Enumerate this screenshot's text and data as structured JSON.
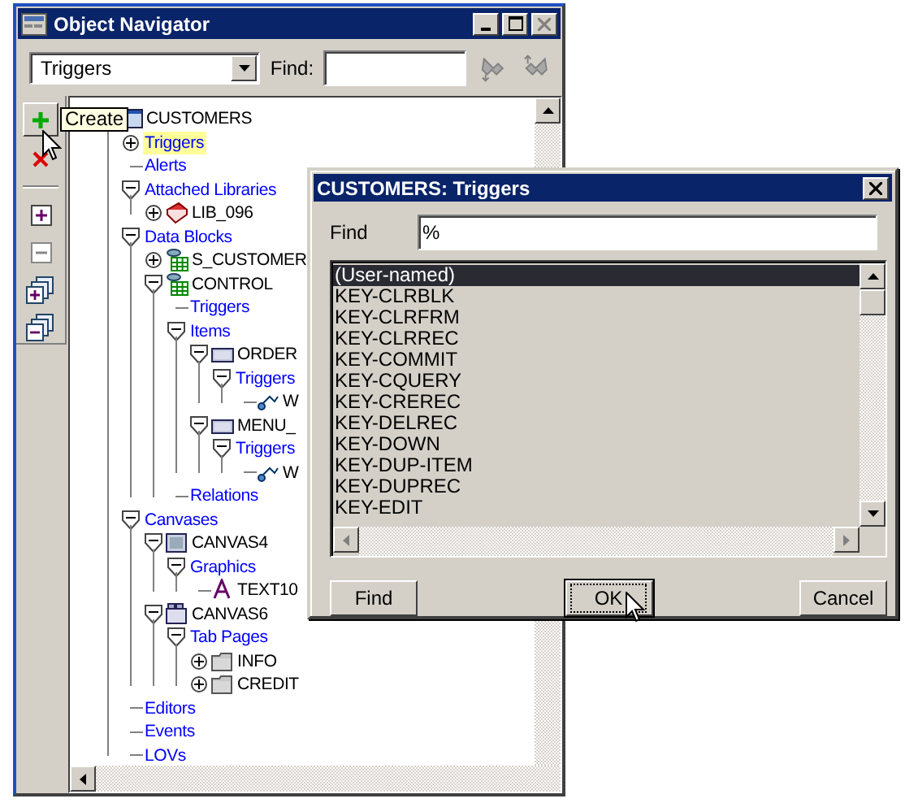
{
  "window": {
    "title": "Object Navigator"
  },
  "toolbar": {
    "filter": "Triggers",
    "find_label": "Find:"
  },
  "side_toolbar": {
    "tooltip": "Create"
  },
  "tree": [
    {
      "label": "CUSTOMERS",
      "kind": "form",
      "selected": false,
      "children": [
        {
          "label": "Triggers",
          "kind": "category",
          "selected": true,
          "expanded": false
        },
        {
          "label": "Alerts",
          "kind": "category",
          "selected": false
        },
        {
          "label": "Attached Libraries",
          "kind": "category",
          "selected": false,
          "expanded": true,
          "children": [
            {
              "label": "LIB_096",
              "kind": "library",
              "selected": false,
              "expanded": false
            }
          ]
        },
        {
          "label": "Data Blocks",
          "kind": "category",
          "selected": false,
          "expanded": true,
          "children": [
            {
              "label": "S_CUSTOMER",
              "kind": "block",
              "selected": false,
              "expanded": false
            },
            {
              "label": "CONTROL",
              "kind": "block",
              "selected": false,
              "expanded": true,
              "children": [
                {
                  "label": "Triggers",
                  "kind": "category",
                  "selected": false
                },
                {
                  "label": "Items",
                  "kind": "category",
                  "selected": false,
                  "expanded": true,
                  "children": [
                    {
                      "label": "ORDER",
                      "kind": "item",
                      "selected": false,
                      "expanded": true,
                      "children": [
                        {
                          "label": "Triggers",
                          "kind": "category",
                          "selected": false,
                          "expanded": true,
                          "children": [
                            {
                              "label": "W",
                              "kind": "trigger",
                              "selected": false
                            }
                          ]
                        }
                      ]
                    },
                    {
                      "label": "MENU_",
                      "kind": "item",
                      "selected": false,
                      "expanded": true,
                      "children": [
                        {
                          "label": "Triggers",
                          "kind": "category",
                          "selected": false,
                          "expanded": true,
                          "children": [
                            {
                              "label": "W",
                              "kind": "trigger",
                              "selected": false
                            }
                          ]
                        }
                      ]
                    }
                  ]
                },
                {
                  "label": "Relations",
                  "kind": "category",
                  "selected": false
                }
              ]
            }
          ]
        },
        {
          "label": "Canvases",
          "kind": "category",
          "selected": false,
          "expanded": true,
          "children": [
            {
              "label": "CANVAS4",
              "kind": "canvas",
              "selected": false,
              "expanded": true,
              "children": [
                {
                  "label": "Graphics",
                  "kind": "category",
                  "selected": false,
                  "expanded": true,
                  "children": [
                    {
                      "label": "TEXT10",
                      "kind": "text",
                      "selected": false
                    }
                  ]
                }
              ]
            },
            {
              "label": "CANVAS6",
              "kind": "tab_canvas",
              "selected": false,
              "expanded": true,
              "children": [
                {
                  "label": "Tab Pages",
                  "kind": "category",
                  "selected": false,
                  "expanded": true,
                  "children": [
                    {
                      "label": "INFO",
                      "kind": "tab_page",
                      "selected": false,
                      "expanded": false
                    },
                    {
                      "label": "CREDIT",
                      "kind": "tab_page",
                      "selected": false,
                      "expanded": false
                    }
                  ]
                }
              ]
            }
          ]
        },
        {
          "label": "Editors",
          "kind": "category",
          "selected": false
        },
        {
          "label": "Events",
          "kind": "category",
          "selected": false
        },
        {
          "label": "LOVs",
          "kind": "category",
          "selected": false
        }
      ]
    }
  ],
  "dialog": {
    "title": "CUSTOMERS: Triggers",
    "find_label": "Find",
    "find_value": "%",
    "items": [
      {
        "label": "(User-named)",
        "selected": true
      },
      {
        "label": "KEY-CLRBLK",
        "selected": false
      },
      {
        "label": "KEY-CLRFRM",
        "selected": false
      },
      {
        "label": "KEY-CLRREC",
        "selected": false
      },
      {
        "label": "KEY-COMMIT",
        "selected": false
      },
      {
        "label": "KEY-CQUERY",
        "selected": false
      },
      {
        "label": "KEY-CREREC",
        "selected": false
      },
      {
        "label": "KEY-DELREC",
        "selected": false
      },
      {
        "label": "KEY-DOWN",
        "selected": false
      },
      {
        "label": "KEY-DUP-ITEM",
        "selected": false
      },
      {
        "label": "KEY-DUPREC",
        "selected": false
      },
      {
        "label": "KEY-EDIT",
        "selected": false
      }
    ],
    "buttons": [
      {
        "label": "Find",
        "default": false
      },
      {
        "label": "OK",
        "default": true
      },
      {
        "label": "Cancel",
        "default": false
      }
    ]
  }
}
